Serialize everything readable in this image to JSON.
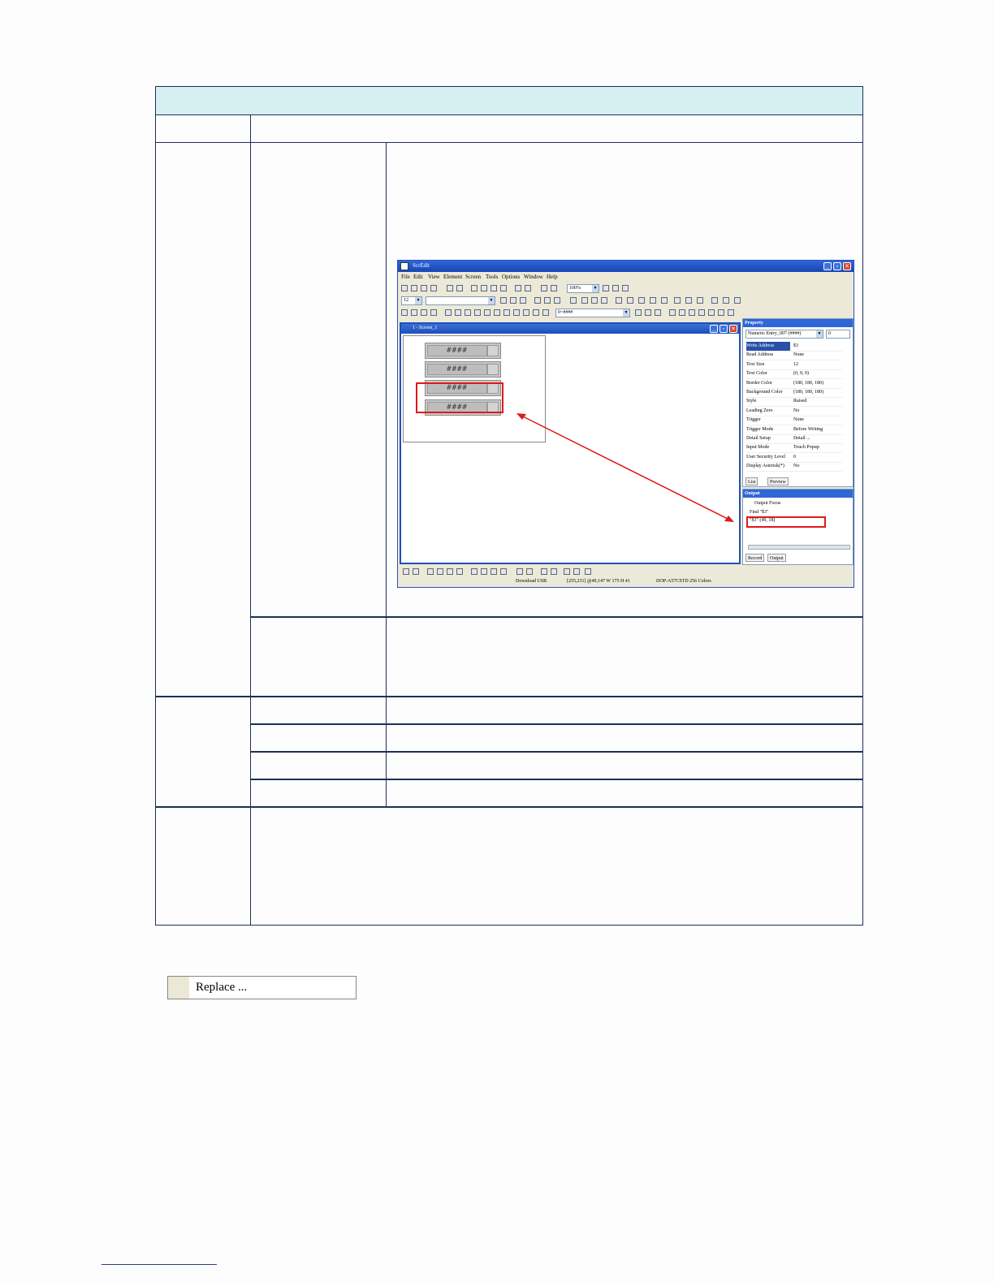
{
  "app": {
    "title": "ScrEdit",
    "menu": [
      "File",
      "Edit",
      "View",
      "Element",
      "Screen",
      "Tools",
      "Options",
      "Window",
      "Help"
    ],
    "zoom": "100%",
    "font_size": "12",
    "format": "0~####",
    "screen_window_title": "1 - Screen_1",
    "numeric_display": "####",
    "property": {
      "title": "Property",
      "selector": "Numeric Entry_007 (####)",
      "selector_index": "0",
      "rows": [
        {
          "k": "Write Address",
          "v": "$3"
        },
        {
          "k": "Read Address",
          "v": "None"
        },
        {
          "k": "Text Size",
          "v": "12"
        },
        {
          "k": "Text Color",
          "v": "(0, 0, 0)"
        },
        {
          "k": "Border Color",
          "v": "(180, 180, 180)"
        },
        {
          "k": "Background Color",
          "v": "(180, 180, 180)"
        },
        {
          "k": "Style",
          "v": "Raised"
        },
        {
          "k": "Leading Zero",
          "v": "No"
        },
        {
          "k": "Trigger",
          "v": "None"
        },
        {
          "k": "Trigger Mode",
          "v": "Before Writing"
        },
        {
          "k": "Detail Setup",
          "v": "Detail ..."
        },
        {
          "k": "Input Mode",
          "v": "Touch Popup"
        },
        {
          "k": "User Security Level",
          "v": "0"
        },
        {
          "k": "Display Asterisk(*)",
          "v": "No"
        }
      ],
      "tabs": [
        "List",
        "Preview"
      ]
    },
    "output": {
      "title": "Output",
      "focus": "Output Focus",
      "find": "Find \"$3\"",
      "result": "\"$3\" (49, 18)",
      "tabs": [
        "Record",
        "Output"
      ]
    },
    "status": {
      "download": "Download USB",
      "coords": "[255,231] @49,147 W 175 H 41",
      "model": "DOP-A57CSTD 256 Colors"
    }
  },
  "replace_label": "Replace ..."
}
